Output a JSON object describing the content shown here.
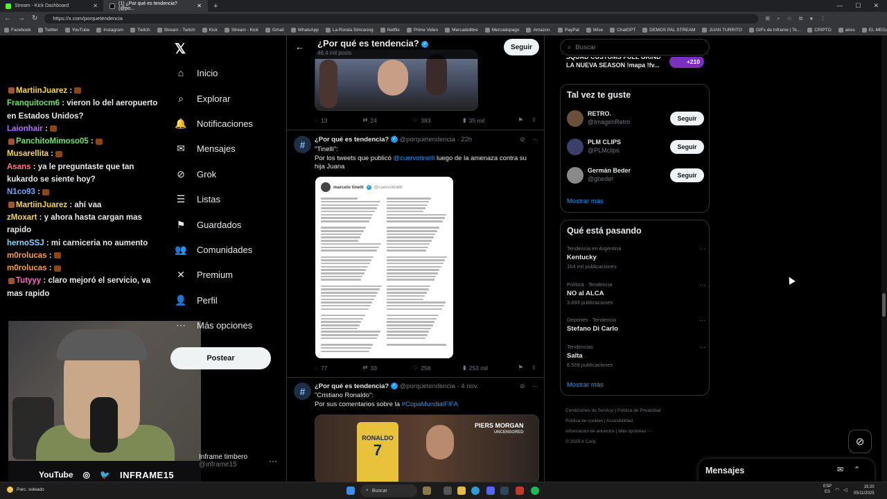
{
  "browser": {
    "tabs": [
      {
        "label": "Stream - Kick Dashboard",
        "active": false
      },
      {
        "label": "(1) ¿Por qué es tendencia? (@po...",
        "active": true
      }
    ],
    "url": "https://x.com/porquetendencia",
    "bookmarks": [
      "Facebook",
      "Twitter",
      "YouTube",
      "Instagram",
      "Twitch",
      "Stream - Twitch",
      "Kick",
      "Stream - Kick",
      "Gmail",
      "WhatsApp",
      "La Ronda Simracing",
      "Netflix",
      "Prime Video",
      "Mercadolibre",
      "Mercadopago",
      "Amazon.",
      "PayPal",
      "Wise",
      "ChatGPT",
      "DEMOS PAL STREAM",
      "JUAN TURRITO",
      "GIFs de Inframe | Te...",
      "CRIPTO",
      "aires",
      "EL MEGA PACK PAP..."
    ]
  },
  "chat": [
    {
      "user": "MartiinJuarez",
      "color": "#f5d742",
      "text": ":",
      "badge": true,
      "emote": true
    },
    {
      "user": "Franquitocm6",
      "color": "#6ee36e",
      "text": ": vieron lo del aeropuerto en Estados Unidos?"
    },
    {
      "user": "Laionhair",
      "color": "#b36bff",
      "text": ":",
      "emote": true
    },
    {
      "user": "PanchitoMimoso05",
      "color": "#6ee36e",
      "text": ":",
      "badge": true,
      "emote": true
    },
    {
      "user": "Musarellita",
      "color": "#f5d742",
      "text": ":",
      "emote": true
    },
    {
      "user": "Asans",
      "color": "#ff7b7b",
      "text": ": ya le preguntaste que tan kukardo se siente hoy?"
    },
    {
      "user": "N1co93",
      "color": "#6fa8ff",
      "text": ":",
      "emote": true
    },
    {
      "user": "MartiinJuarez",
      "color": "#f5d742",
      "text": ": ahí vaa",
      "badge": true
    },
    {
      "user": "zMoxart",
      "color": "#f5d742",
      "text": ": y ahora hasta cargan mas rapido"
    },
    {
      "user": "hernoSSJ",
      "color": "#8ad8ff",
      "text": ": mi carniceria no aumento"
    },
    {
      "user": "m0rolucas",
      "color": "#f5a142",
      "text": ":",
      "emote": true
    },
    {
      "user": "m0rolucas",
      "color": "#f5a142",
      "text": ":",
      "emote": true
    },
    {
      "user": "Tutyyy",
      "color": "#ff66cc",
      "text": ": claro mejoró el servicio, va mas rapido",
      "badge": true
    }
  ],
  "stream_bar": {
    "platforms": [
      "YouTube"
    ],
    "brand": "INFRAME15"
  },
  "nav": {
    "items": [
      {
        "label": "Inicio",
        "icon": "home-icon",
        "glyph": "⌂"
      },
      {
        "label": "Explorar",
        "icon": "search-icon",
        "glyph": "⌕"
      },
      {
        "label": "Notificaciones",
        "icon": "bell-icon",
        "glyph": "🔔"
      },
      {
        "label": "Mensajes",
        "icon": "mail-icon",
        "glyph": "✉"
      },
      {
        "label": "Grok",
        "icon": "grok-icon",
        "glyph": "⊘"
      },
      {
        "label": "Listas",
        "icon": "list-icon",
        "glyph": "☰"
      },
      {
        "label": "Guardados",
        "icon": "bookmark-icon",
        "glyph": "⚑"
      },
      {
        "label": "Comunidades",
        "icon": "communities-icon",
        "glyph": "👥"
      },
      {
        "label": "Premium",
        "icon": "x-premium-icon",
        "glyph": "✕"
      },
      {
        "label": "Perfil",
        "icon": "profile-icon",
        "glyph": "👤"
      },
      {
        "label": "Más opciones",
        "icon": "more-icon",
        "glyph": "⋯"
      }
    ],
    "post_label": "Postear",
    "account_name": "Inframe timbero",
    "account_handle": "@inframe15"
  },
  "profile_header": {
    "title": "¿Por qué es tendencia?",
    "posts": "46,4 mil posts",
    "follow_label": "Seguir"
  },
  "tweets": [
    {
      "actions": {
        "replies": "13",
        "reposts": "24",
        "likes": "383",
        "views": "35 mil"
      }
    },
    {
      "author": "¿Por qué es tendencia?",
      "handle": "@porquetendencia",
      "time": "· 22h",
      "quote": "\"Tinelli\":",
      "text_before": "Por los tweets que publicó ",
      "mention": "@cuervotinelli",
      "text_after": " luego de la amenaza contra su hija Juana",
      "card": {
        "name": "marcelo tinelli",
        "handle": "@cuervotinelli"
      },
      "actions": {
        "replies": "77",
        "reposts": "33",
        "likes": "256",
        "views": "253 mil"
      }
    },
    {
      "author": "¿Por qué es tendencia?",
      "handle": "@porquetendencia",
      "time": "· 4 nov.",
      "quote": "\"Cristiano Ronaldo\":",
      "text_before": "Por sus comentarios sobre la ",
      "hashtag": "#CopaMundialFIFA",
      "media_label": "PIERS MORGAN",
      "media_sub": "UNCENSORED",
      "jersey_name": "RONALDO",
      "jersey_number": "7"
    }
  ],
  "right": {
    "search_placeholder": "Buscar",
    "squad_text": "SQUAD CUSTOMS FULL GRIND LA NUEVA SEASON !mapa !fv...",
    "squad_count": "+210",
    "suggest_title": "Tal vez te guste",
    "suggestions": [
      {
        "name": "RETRO.",
        "handle": "@ImagenRetro",
        "follow": "Seguir"
      },
      {
        "name": "PLM CLIPS",
        "handle": "@PLMclips",
        "follow": "Seguir"
      },
      {
        "name": "Germán Beder",
        "handle": "@gbeder",
        "follow": "Seguir"
      }
    ],
    "show_more": "Mostrar más",
    "trends_title": "Qué está pasando",
    "trends": [
      {
        "context": "Tendencia en Argentina",
        "topic": "Kentucky",
        "count": "164 mil publicaciones"
      },
      {
        "context": "Política · Tendencia",
        "topic": "NO al ALCA",
        "count": "3.693 publicaciones"
      },
      {
        "context": "Deportes · Tendencia",
        "topic": "Stefano Di Carlo",
        "count": ""
      },
      {
        "context": "Tendencias",
        "topic": "Salta",
        "count": "6.559 publicaciones"
      }
    ],
    "trends_more": "Mostrar más",
    "footer": [
      "Condiciones de Servicio",
      "Política de Privacidad",
      "Política de cookies",
      "Accesibilidad",
      "Información de anuncios",
      "Más opciones ···",
      "© 2025 X Corp."
    ]
  },
  "messages_drawer": {
    "label": "Mensajes"
  },
  "taskbar": {
    "weather": "Parc. soleado",
    "search": "Buscar",
    "lang_top": "ESP",
    "lang_bottom": "ES",
    "time": "15:20",
    "date": "05/11/2025"
  }
}
